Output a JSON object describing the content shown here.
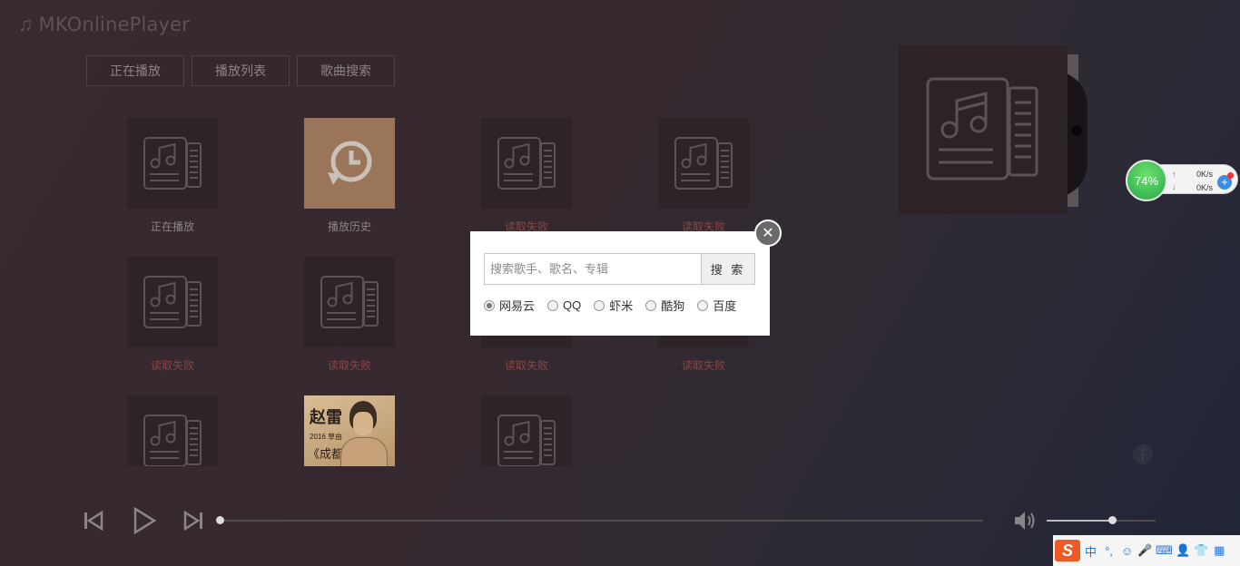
{
  "app": {
    "title": "MKOnlinePlayer"
  },
  "nav": {
    "buttons": [
      "正在播放",
      "播放列表",
      "歌曲搜索"
    ]
  },
  "grid": {
    "tiles": [
      {
        "label": "正在播放",
        "status": "normal",
        "cover": "music-list-icon"
      },
      {
        "label": "播放历史",
        "status": "normal",
        "cover": "history-icon"
      },
      {
        "label": "读取失败",
        "status": "fail",
        "cover": "music-list-icon"
      },
      {
        "label": "读取失败",
        "status": "fail",
        "cover": "music-list-icon"
      },
      {
        "label": "读取失败",
        "status": "fail",
        "cover": "music-list-icon"
      },
      {
        "label": "读取失败",
        "status": "fail",
        "cover": "music-list-icon"
      },
      {
        "label": "读取失败",
        "status": "fail",
        "cover": "music-list-icon"
      },
      {
        "label": "读取失败",
        "status": "fail",
        "cover": "music-list-icon"
      },
      {
        "label": "",
        "status": "normal",
        "cover": "music-list-icon"
      },
      {
        "label": "",
        "status": "normal",
        "cover": "album-photo"
      },
      {
        "label": "",
        "status": "normal",
        "cover": "music-list-icon"
      }
    ],
    "photo_text": [
      "赵雷",
      "2016 草由",
      "《成都》"
    ]
  },
  "search_dialog": {
    "placeholder": "搜索歌手、歌名、专辑",
    "value": "",
    "button": "搜 索",
    "sources": [
      {
        "label": "网易云",
        "checked": true
      },
      {
        "label": "QQ",
        "checked": false
      },
      {
        "label": "虾米",
        "checked": false
      },
      {
        "label": "酷狗",
        "checked": false
      },
      {
        "label": "百度",
        "checked": false
      }
    ]
  },
  "speed_widget": {
    "percent": "74%",
    "up": "0K/s",
    "down": "0K/s"
  },
  "player": {
    "progress": 0.0,
    "volume": 0.6
  },
  "taskbar": {
    "ime": "S",
    "items": [
      "中",
      "°,",
      "☺",
      "🎤",
      "⌨",
      "👤",
      "👕",
      "▦"
    ]
  },
  "colors": {
    "fail": "#8a4545",
    "accent": "#27a84a"
  }
}
